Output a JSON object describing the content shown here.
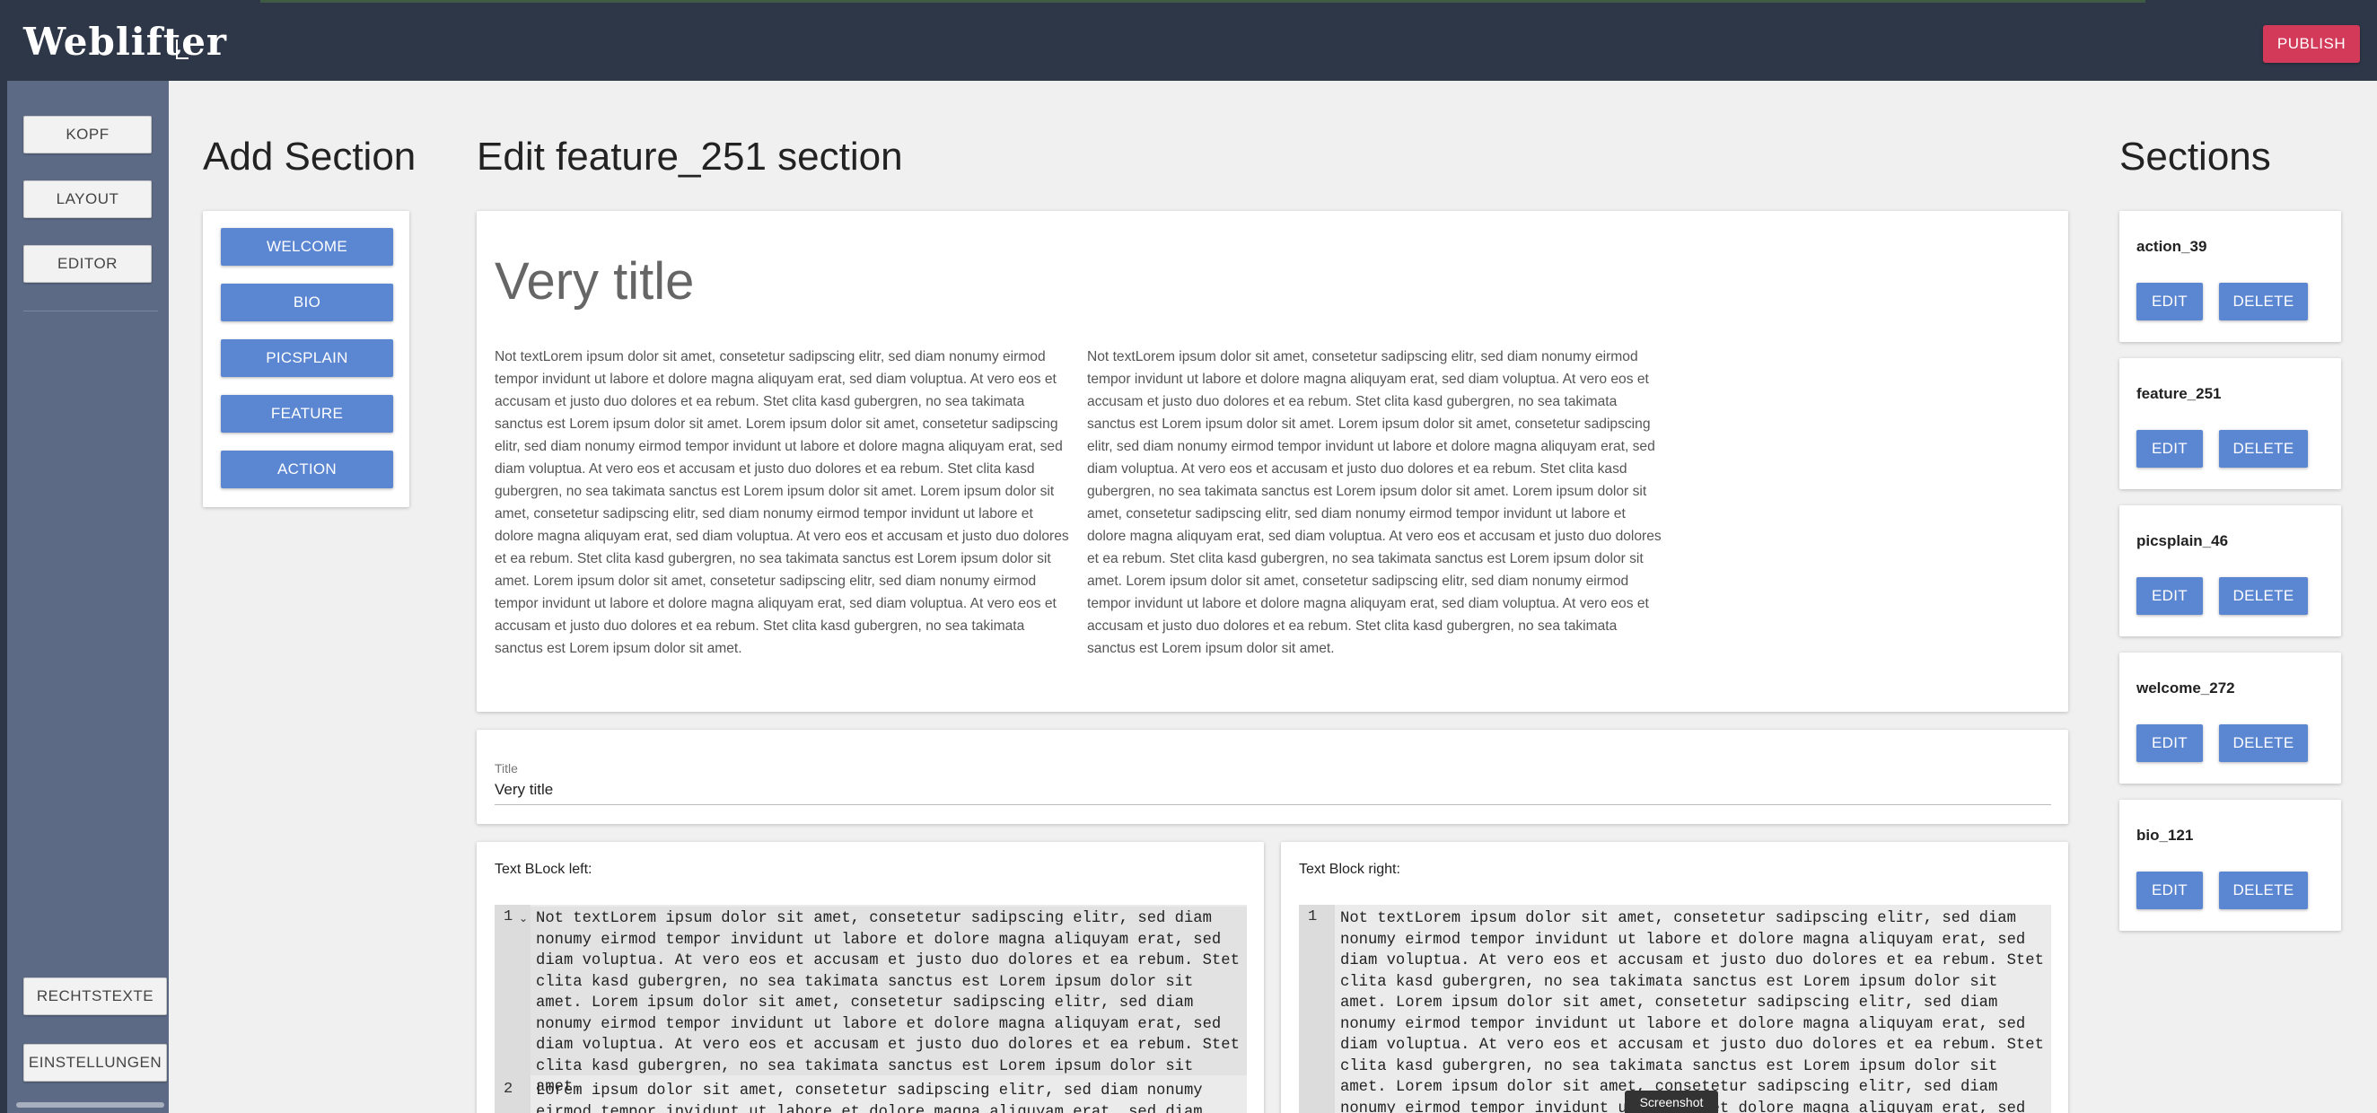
{
  "header": {
    "logo": "Weblifter",
    "publish_label": "PUBLISH"
  },
  "sidebar": {
    "top_items": [
      {
        "label": "KOPF"
      },
      {
        "label": "LAYOUT"
      },
      {
        "label": "EDITOR"
      }
    ],
    "bottom_items": [
      {
        "label": "RECHTSTEXTE"
      },
      {
        "label": "EINSTELLUNGEN"
      }
    ]
  },
  "add_section": {
    "title": "Add Section",
    "buttons": [
      {
        "label": "WELCOME"
      },
      {
        "label": "BIO"
      },
      {
        "label": "PICSPLAIN"
      },
      {
        "label": "FEATURE"
      },
      {
        "label": "ACTION"
      }
    ]
  },
  "editor": {
    "title": "Edit feature_251 section",
    "preview": {
      "title": "Very title",
      "text_left": "Not textLorem ipsum dolor sit amet, consetetur sadipscing elitr, sed diam nonumy eirmod tempor invidunt ut labore et dolore magna aliquyam erat, sed diam voluptua. At vero eos et accusam et justo duo dolores et ea rebum. Stet clita kasd gubergren, no sea takimata sanctus est Lorem ipsum dolor sit amet. Lorem ipsum dolor sit amet, consetetur sadipscing elitr, sed diam nonumy eirmod tempor invidunt ut labore et dolore magna aliquyam erat, sed diam voluptua. At vero eos et accusam et justo duo dolores et ea rebum. Stet clita kasd gubergren, no sea takimata sanctus est Lorem ipsum dolor sit amet. Lorem ipsum dolor sit amet, consetetur sadipscing elitr, sed diam nonumy eirmod tempor invidunt ut labore et dolore magna aliquyam erat, sed diam voluptua. At vero eos et accusam et justo duo dolores et ea rebum. Stet clita kasd gubergren, no sea takimata sanctus est Lorem ipsum dolor sit amet. Lorem ipsum dolor sit amet, consetetur sadipscing elitr, sed diam nonumy eirmod tempor invidunt ut labore et dolore magna aliquyam erat, sed diam voluptua. At vero eos et accusam et justo duo dolores et ea rebum. Stet clita kasd gubergren, no sea takimata sanctus est Lorem ipsum dolor sit amet.",
      "text_right": "Not textLorem ipsum dolor sit amet, consetetur sadipscing elitr, sed diam nonumy eirmod tempor invidunt ut labore et dolore magna aliquyam erat, sed diam voluptua. At vero eos et accusam et justo duo dolores et ea rebum. Stet clita kasd gubergren, no sea takimata sanctus est Lorem ipsum dolor sit amet. Lorem ipsum dolor sit amet, consetetur sadipscing elitr, sed diam nonumy eirmod tempor invidunt ut labore et dolore magna aliquyam erat, sed diam voluptua. At vero eos et accusam et justo duo dolores et ea rebum. Stet clita kasd gubergren, no sea takimata sanctus est Lorem ipsum dolor sit amet. Lorem ipsum dolor sit amet, consetetur sadipscing elitr, sed diam nonumy eirmod tempor invidunt ut labore et dolore magna aliquyam erat, sed diam voluptua. At vero eos et accusam et justo duo dolores et ea rebum. Stet clita kasd gubergren, no sea takimata sanctus est Lorem ipsum dolor sit amet. Lorem ipsum dolor sit amet, consetetur sadipscing elitr, sed diam nonumy eirmod tempor invidunt ut labore et dolore magna aliquyam erat, sed diam voluptua. At vero eos et accusam et justo duo dolores et ea rebum. Stet clita kasd gubergren, no sea takimata sanctus est Lorem ipsum dolor sit amet."
    },
    "title_field": {
      "label": "Title",
      "value": "Very title"
    },
    "block_left": {
      "label": "Text BLock left:",
      "line1_no": "1",
      "line1": "Not textLorem ipsum dolor sit amet, consetetur sadipscing elitr, sed diam nonumy eirmod tempor invidunt ut labore et dolore magna aliquyam erat, sed diam voluptua. At vero eos et accusam et justo duo dolores et ea rebum. Stet clita kasd gubergren, no sea takimata sanctus est Lorem ipsum dolor sit amet. Lorem ipsum dolor sit amet, consetetur sadipscing elitr, sed diam nonumy eirmod tempor invidunt ut labore et dolore magna aliquyam erat, sed diam voluptua. At vero eos et accusam et justo duo dolores et ea rebum. Stet clita kasd gubergren, no sea takimata sanctus est Lorem ipsum dolor sit amet.",
      "line2_no": "2",
      "line2": "Lorem ipsum dolor sit amet, consetetur sadipscing elitr, sed diam nonumy eirmod tempor invidunt ut labore et dolore magna aliquyam erat, sed diam voluptua."
    },
    "block_right": {
      "label": "Text Block right:",
      "line1_no": "1",
      "line1": "Not textLorem ipsum dolor sit amet, consetetur sadipscing elitr, sed diam nonumy eirmod tempor invidunt ut labore et dolore magna aliquyam erat, sed diam voluptua. At vero eos et accusam et justo duo dolores et ea rebum. Stet clita kasd gubergren, no sea takimata sanctus est Lorem ipsum dolor sit amet. Lorem ipsum dolor sit amet, consetetur sadipscing elitr, sed diam nonumy eirmod tempor invidunt ut labore et dolore magna aliquyam erat, sed diam voluptua. At vero eos et accusam et justo duo dolores et ea rebum. Stet clita kasd gubergren, no sea takimata sanctus est Lorem ipsum dolor sit amet. Lorem ipsum dolor sit amet, consetetur sadipscing elitr, sed diam nonumy eirmod tempor invidunt ut labore et dolore magna aliquyam erat, sed diam voluptua."
    }
  },
  "sections": {
    "title": "Sections",
    "edit_label": "EDIT",
    "delete_label": "DELETE",
    "items": [
      {
        "name": "action_39"
      },
      {
        "name": "feature_251"
      },
      {
        "name": "picsplain_46"
      },
      {
        "name": "welcome_272"
      },
      {
        "name": "bio_121"
      }
    ]
  },
  "tooltip": "Screenshot"
}
